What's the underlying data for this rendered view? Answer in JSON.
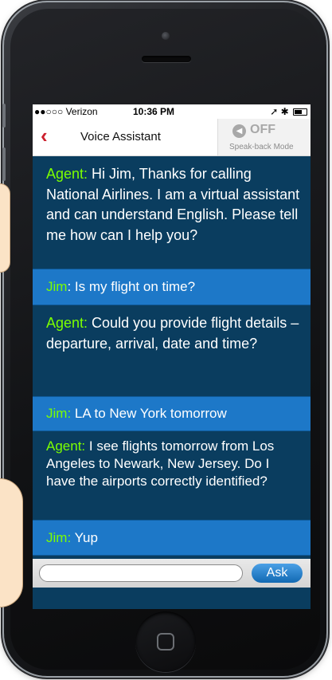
{
  "status_bar": {
    "carrier": "●●○○○ Verizon",
    "time": "10:36 PM",
    "right_icons": "➚ ✱"
  },
  "header": {
    "back_icon": "back-chevron",
    "title": "Voice Assistant",
    "speak_toggle": "OFF",
    "speak_caption": "Speak-back Mode"
  },
  "messages": [
    {
      "speaker": "Agent:",
      "text": " Hi Jim, Thanks for calling National Airlines. I am a virtual assistant and can understand English.  Please tell me how can I help you?"
    },
    {
      "speaker": "Jim",
      "text": ": Is my flight on time?"
    },
    {
      "speaker": "Agent:",
      "text": " Could you provide flight details – departure, arrival, date and time?"
    },
    {
      "speaker": "Jim:",
      "text": " LA to New York tomorrow"
    },
    {
      "speaker": "Agent:",
      "text": " I see flights tomorrow from Los Angeles to Newark, New Jersey.  Do I have the airports correctly identified?"
    },
    {
      "speaker": "Jim:",
      "text": " Yup"
    }
  ],
  "input": {
    "placeholder": "",
    "ask_label": "Ask"
  },
  "colors": {
    "agent_bg": "#0a3d5f",
    "user_bg": "#1d78c8",
    "speaker_label": "#7cff00",
    "back_chevron": "#cc1f2d"
  }
}
